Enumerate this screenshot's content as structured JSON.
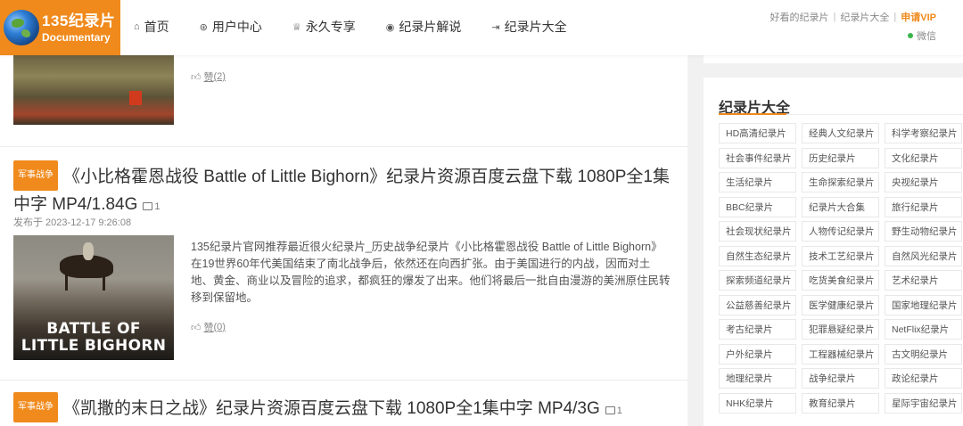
{
  "header": {
    "logo": {
      "cn": "135纪录片",
      "en": "Documentary"
    },
    "nav": [
      {
        "icon": "home-icon",
        "glyph": "⌂",
        "label": "首页"
      },
      {
        "icon": "user-icon",
        "glyph": "⊛",
        "label": "用户中心"
      },
      {
        "icon": "trophy-icon",
        "glyph": "♕",
        "label": "永久专享"
      },
      {
        "icon": "broadcast-icon",
        "glyph": "◉",
        "label": "纪录片解说"
      },
      {
        "icon": "external-link-icon",
        "glyph": "⇥",
        "label": "纪录片大全"
      }
    ],
    "top_links": [
      "好看的纪录片",
      "纪录片大全"
    ],
    "vip_label": "申请VIP",
    "wechat_label": "微信"
  },
  "posts": [
    {
      "likes_label": "赞",
      "likes": "(2)"
    },
    {
      "tag": "军事战争",
      "title": "《小比格霍恩战役 Battle of Little Bighorn》纪录片资源百度云盘下载 1080P全1集中字 MP4/1.84G",
      "img_count": "1",
      "date": "发布于 2023-12-17 9:26:08",
      "excerpt": "135纪录片官网推荐最近很火纪录片_历史战争纪录片《小比格霍恩战役 Battle of Little Bighorn》在19世界60年代美国结束了南北战争后，依然还在向西扩张。由于美国进行的内战，因而对土地、黄金、商业以及冒险的追求，都疯狂的爆发了出来。他们将最后一批自由漫游的美洲原住民转移到保留地。",
      "thumb_text": "BATTLE OF LITTLE BIGHORN",
      "thumb_line1": "BATTLE OF",
      "thumb_line2": "LITTLE BIGHORN",
      "likes_label": "赞",
      "likes": "(0)"
    },
    {
      "tag": "军事战争",
      "title": "《凯撒的末日之战》纪录片资源百度云盘下载 1080P全1集中字 MP4/3G",
      "img_count": "1"
    }
  ],
  "sidebar": {
    "title": "纪录片大全",
    "categories": [
      "HD高清纪录片",
      "经典人文纪录片",
      "科学考察纪录片",
      "社会事件纪录片",
      "历史纪录片",
      "文化纪录片",
      "生活纪录片",
      "生命探索纪录片",
      "央视纪录片",
      "BBC纪录片",
      "纪录片大合集",
      "旅行纪录片",
      "社会现状纪录片",
      "人物传记纪录片",
      "野生动物纪录片",
      "自然生态纪录片",
      "技术工艺纪录片",
      "自然风光纪录片",
      "探索频道纪录片",
      "吃货美食纪录片",
      "艺术纪录片",
      "公益慈善纪录片",
      "医学健康纪录片",
      "国家地理纪录片",
      "考古纪录片",
      "犯罪悬疑纪录片",
      "NetFlix纪录片",
      "户外纪录片",
      "工程器械纪录片",
      "古文明纪录片",
      "地理纪录片",
      "战争纪录片",
      "政论纪录片",
      "NHK纪录片",
      "教育纪录片",
      "星际宇宙纪录片"
    ]
  },
  "colors": {
    "accent": "#f08a1c",
    "online": "#3ab54a"
  }
}
